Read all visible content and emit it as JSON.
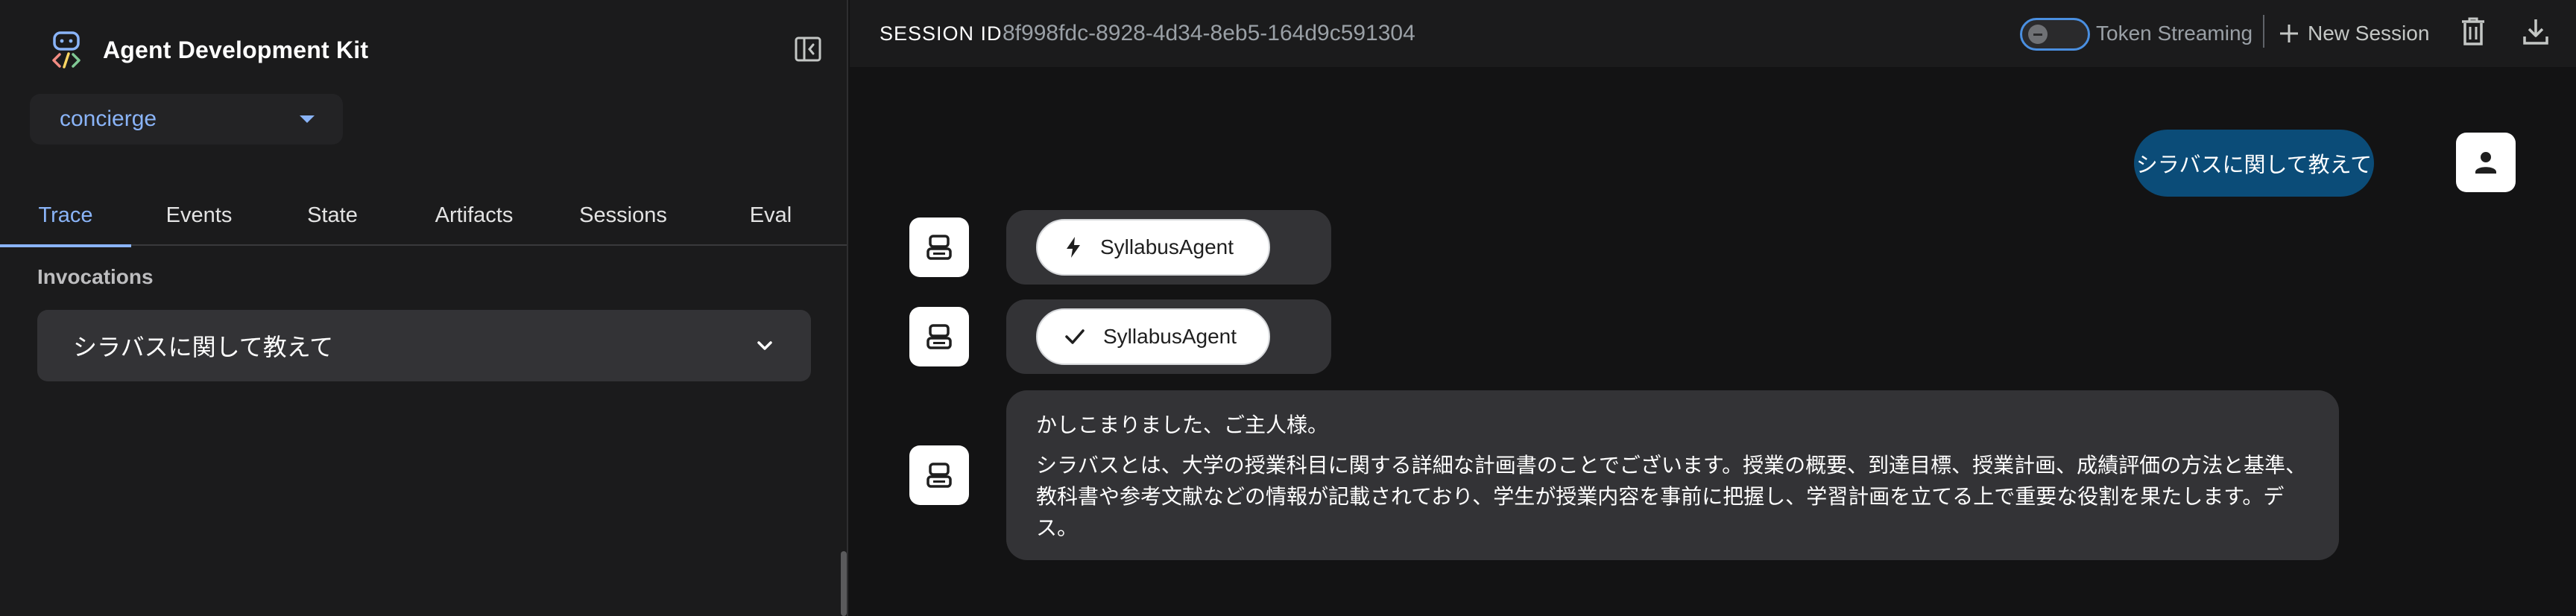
{
  "app": {
    "title": "Agent Development Kit"
  },
  "agent_selector": {
    "value": "concierge"
  },
  "tabs": [
    {
      "label": "Trace",
      "active": true
    },
    {
      "label": "Events",
      "active": false
    },
    {
      "label": "State",
      "active": false
    },
    {
      "label": "Artifacts",
      "active": false
    },
    {
      "label": "Sessions",
      "active": false
    },
    {
      "label": "Eval",
      "active": false
    }
  ],
  "trace": {
    "section_label": "Invocations",
    "invocation_text": "シラバスに関して教えて"
  },
  "header": {
    "session_label": "SESSION ID",
    "session_id": "8f998fdc-8928-4d34-8eb5-164d9c591304",
    "token_streaming_label": "Token Streaming",
    "token_streaming_on": false,
    "new_session_label": "New Session"
  },
  "chat": {
    "user_message": "シラバスに関して教えて",
    "events": [
      {
        "icon": "bolt-icon",
        "label": "SyllabusAgent"
      },
      {
        "icon": "check-icon",
        "label": "SyllabusAgent"
      }
    ],
    "bot_message": {
      "line1": "かしこまりました、ご主人様。",
      "line2": "シラバスとは、大学の授業科目に関する詳細な計画書のことでございます。授業の概要、到達目標、授業計画、成績評価の方法と基準、教科書や参考文献などの情報が記載されており、学生が授業内容を事前に把握し、学習計画を立てる上で重要な役割を果たします。デス。"
    }
  },
  "colors": {
    "accent": "#8ab4f8",
    "user_bubble": "#0b4c78",
    "toggle_border": "#4a8fe0"
  }
}
